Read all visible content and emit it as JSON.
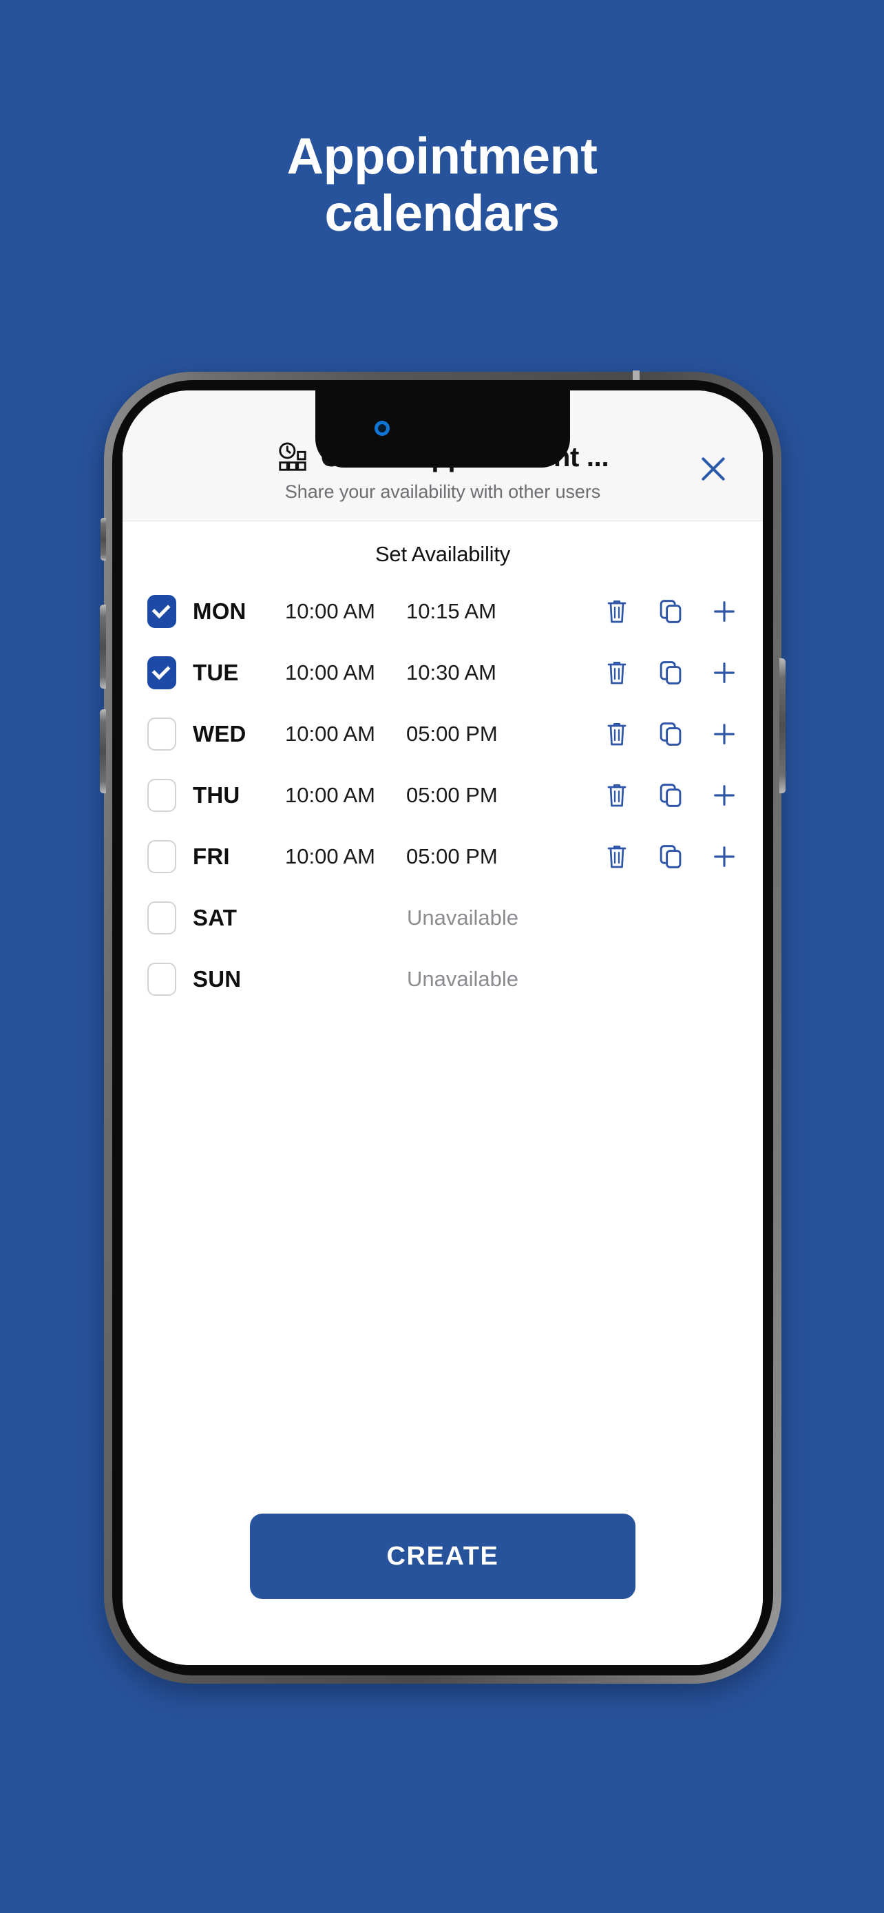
{
  "marketing": {
    "headline_line1": "Appointment",
    "headline_line2": "calendars",
    "background_color": "#27529C"
  },
  "dialog": {
    "icon": "appointment-clock-grid-icon",
    "title": "Create Appointment ...",
    "subtitle": "Share your availability with other users",
    "close_icon": "close-icon",
    "close_color": "#2B5AA8"
  },
  "section": {
    "title": "Set Availability"
  },
  "accent_color": "#1D49A7",
  "row_icons": {
    "delete": "trash-icon",
    "duplicate": "copy-icon",
    "add": "plus-icon"
  },
  "days": [
    {
      "label": "MON",
      "checked": true,
      "available": true,
      "start": "10:00 AM",
      "end": "10:15 AM",
      "status": ""
    },
    {
      "label": "TUE",
      "checked": true,
      "available": true,
      "start": "10:00 AM",
      "end": "10:30 AM",
      "status": ""
    },
    {
      "label": "WED",
      "checked": false,
      "available": true,
      "start": "10:00 AM",
      "end": "05:00 PM",
      "status": ""
    },
    {
      "label": "THU",
      "checked": false,
      "available": true,
      "start": "10:00 AM",
      "end": "05:00 PM",
      "status": ""
    },
    {
      "label": "FRI",
      "checked": false,
      "available": true,
      "start": "10:00 AM",
      "end": "05:00 PM",
      "status": ""
    },
    {
      "label": "SAT",
      "checked": false,
      "available": false,
      "start": "",
      "end": "",
      "status": "Unavailable"
    },
    {
      "label": "SUN",
      "checked": false,
      "available": false,
      "start": "",
      "end": "",
      "status": "Unavailable"
    }
  ],
  "footer": {
    "create_label": "CREATE"
  }
}
